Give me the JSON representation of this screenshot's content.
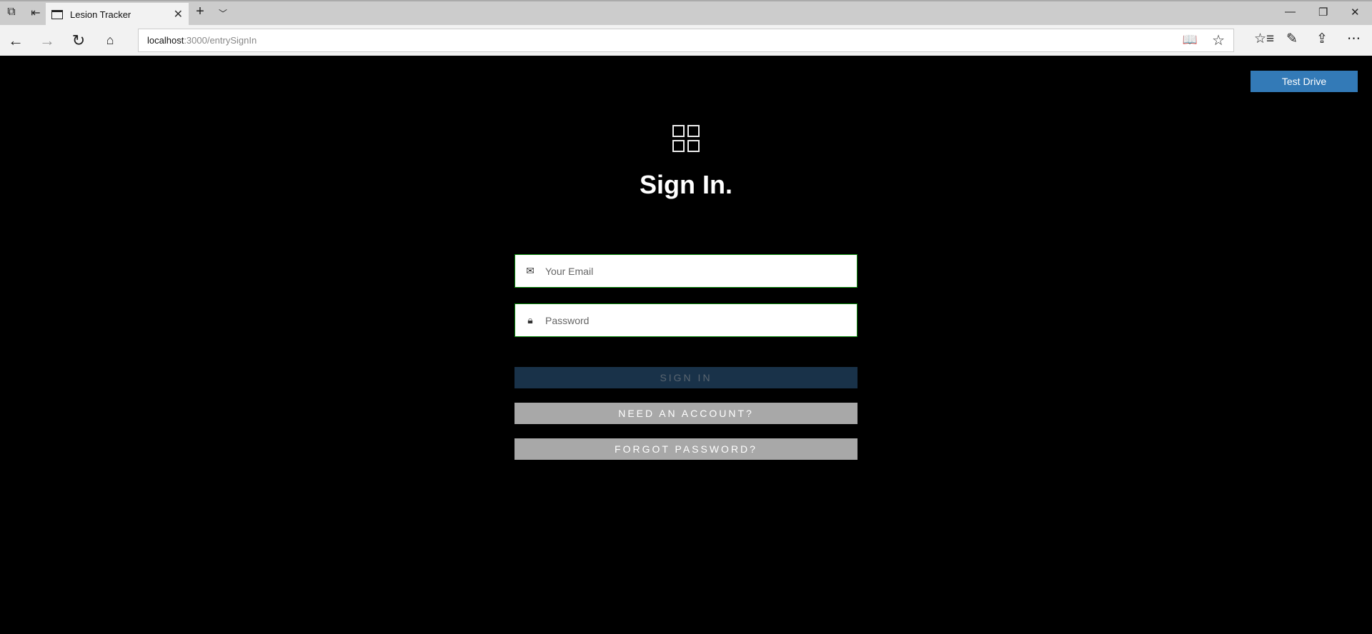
{
  "browser": {
    "tab_title": "Lesion Tracker",
    "url_host": "localhost",
    "url_path": ":3000/entrySignIn"
  },
  "page": {
    "test_drive_label": "Test Drive",
    "title": "Sign In.",
    "email_placeholder": "Your Email",
    "password_placeholder": "Password",
    "sign_in_label": "SIGN IN",
    "need_account_label": "NEED AN ACCOUNT?",
    "forgot_password_label": "FORGOT PASSWORD?"
  },
  "colors": {
    "test_drive": "#337ab7",
    "sign_in_bg": "#193249",
    "secondary_bg": "#a8a8a8",
    "field_border": "#0a8a0a"
  }
}
